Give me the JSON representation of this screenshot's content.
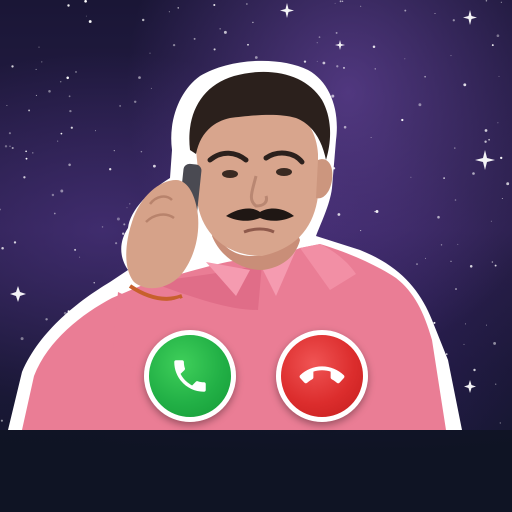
{
  "screen": {
    "background": "starry-night-sky",
    "caller_image": "man-in-pink-shirt-on-phone-sticker"
  },
  "actions": {
    "accept": {
      "icon": "phone-icon",
      "color": "#22b046"
    },
    "decline": {
      "icon": "phone-hangup-icon",
      "color": "#dc2d2d"
    }
  },
  "colors": {
    "background_top": "#2a1f4c",
    "background_bottom": "#0f1424",
    "sticker_outline": "#ffffff",
    "shirt": "#ea7d95"
  }
}
